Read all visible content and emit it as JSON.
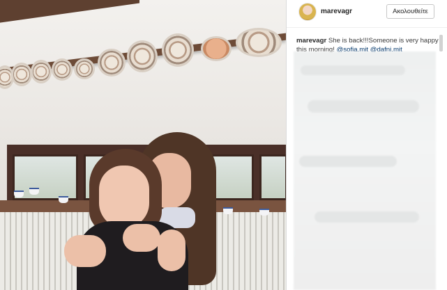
{
  "post": {
    "photo_alt": "photo",
    "username": "marevagr",
    "follow_label": "Ακολουθείτε",
    "caption": {
      "username": "marevagr",
      "text": "She is back!!!Someone is very happy this morning!",
      "mentions": [
        "@sofia.mit",
        "@dafni.mit"
      ]
    }
  },
  "colors": {
    "mention": "#003569",
    "text": "#262626",
    "border": "#dbdbdb"
  },
  "icons": {
    "avatar": "profile-avatar"
  }
}
